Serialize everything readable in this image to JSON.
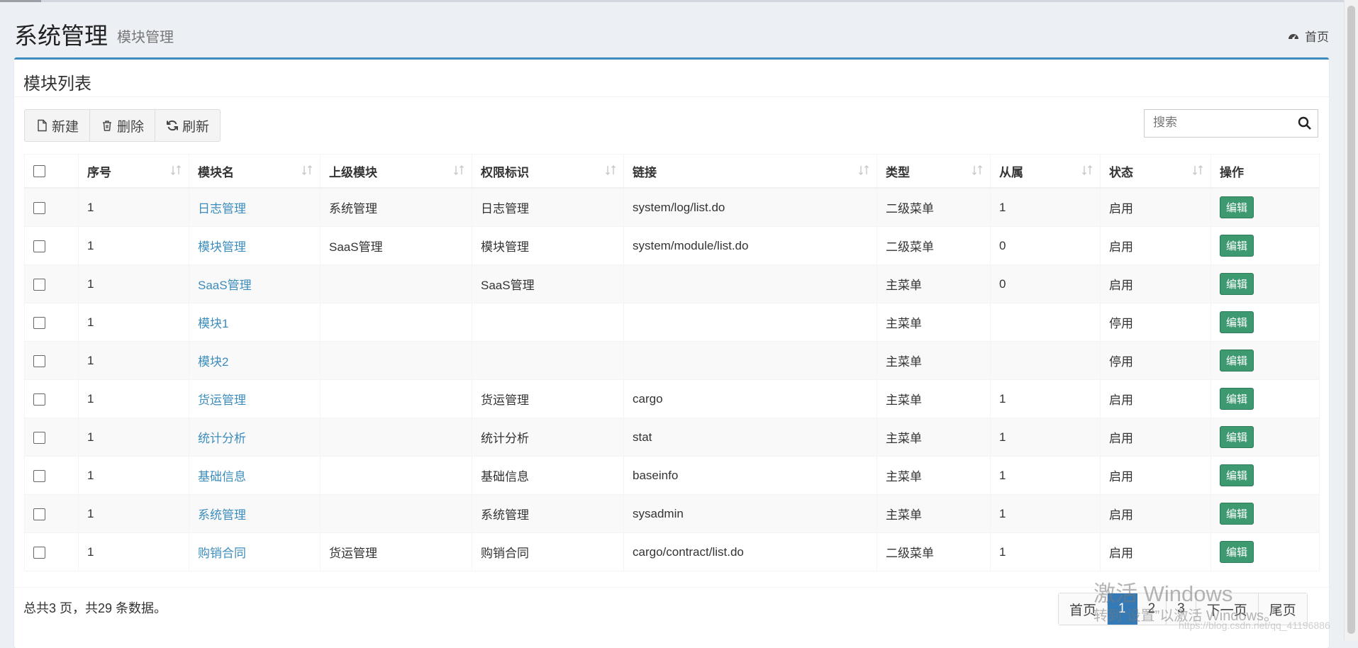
{
  "header": {
    "title": "系统管理",
    "subtitle": "模块管理",
    "breadcrumb_home": "首页"
  },
  "box": {
    "title": "模块列表"
  },
  "toolbar": {
    "new_label": "新建",
    "delete_label": "删除",
    "refresh_label": "刷新"
  },
  "search": {
    "placeholder": "搜索"
  },
  "table": {
    "columns": [
      "序号",
      "模块名",
      "上级模块",
      "权限标识",
      "链接",
      "类型",
      "从属",
      "状态",
      "操作"
    ],
    "rows": [
      {
        "no": "1",
        "name": "日志管理",
        "parent": "系统管理",
        "perm": "日志管理",
        "link": "system/log/list.do",
        "type": "二级菜单",
        "belong": "1",
        "status": "启用",
        "action": "编辑"
      },
      {
        "no": "1",
        "name": "模块管理",
        "parent": "SaaS管理",
        "perm": "模块管理",
        "link": "system/module/list.do",
        "type": "二级菜单",
        "belong": "0",
        "status": "启用",
        "action": "编辑"
      },
      {
        "no": "1",
        "name": "SaaS管理",
        "parent": "",
        "perm": "SaaS管理",
        "link": "",
        "type": "主菜单",
        "belong": "0",
        "status": "启用",
        "action": "编辑"
      },
      {
        "no": "1",
        "name": "模块1",
        "parent": "",
        "perm": "",
        "link": "",
        "type": "主菜单",
        "belong": "",
        "status": "停用",
        "action": "编辑"
      },
      {
        "no": "1",
        "name": "模块2",
        "parent": "",
        "perm": "",
        "link": "",
        "type": "主菜单",
        "belong": "",
        "status": "停用",
        "action": "编辑"
      },
      {
        "no": "1",
        "name": "货运管理",
        "parent": "",
        "perm": "货运管理",
        "link": "cargo",
        "type": "主菜单",
        "belong": "1",
        "status": "启用",
        "action": "编辑"
      },
      {
        "no": "1",
        "name": "统计分析",
        "parent": "",
        "perm": "统计分析",
        "link": "stat",
        "type": "主菜单",
        "belong": "1",
        "status": "启用",
        "action": "编辑"
      },
      {
        "no": "1",
        "name": "基础信息",
        "parent": "",
        "perm": "基础信息",
        "link": "baseinfo",
        "type": "主菜单",
        "belong": "1",
        "status": "启用",
        "action": "编辑"
      },
      {
        "no": "1",
        "name": "系统管理",
        "parent": "",
        "perm": "系统管理",
        "link": "sysadmin",
        "type": "主菜单",
        "belong": "1",
        "status": "启用",
        "action": "编辑"
      },
      {
        "no": "1",
        "name": "购销合同",
        "parent": "货运管理",
        "perm": "购销合同",
        "link": "cargo/contract/list.do",
        "type": "二级菜单",
        "belong": "1",
        "status": "启用",
        "action": "编辑"
      }
    ]
  },
  "footer": {
    "summary": "总共3 页，共29 条数据。",
    "pages": [
      "首页",
      "1",
      "2",
      "3",
      "下一页",
      "尾页"
    ],
    "active_page": "1"
  },
  "watermark": {
    "line1": "激活 Windows",
    "line2": "转到“设置”以激活 Windows。",
    "url": "https://blog.csdn.net/qq_41196886"
  },
  "colors": {
    "accent": "#3c8dbc",
    "edit_button": "#3d9970",
    "active_page": "#337ab7"
  },
  "icons": {
    "breadcrumb": "dashboard-icon",
    "new": "file-icon",
    "delete": "trash-icon",
    "refresh": "refresh-icon",
    "search": "search-icon",
    "sort": "sort-icon"
  }
}
